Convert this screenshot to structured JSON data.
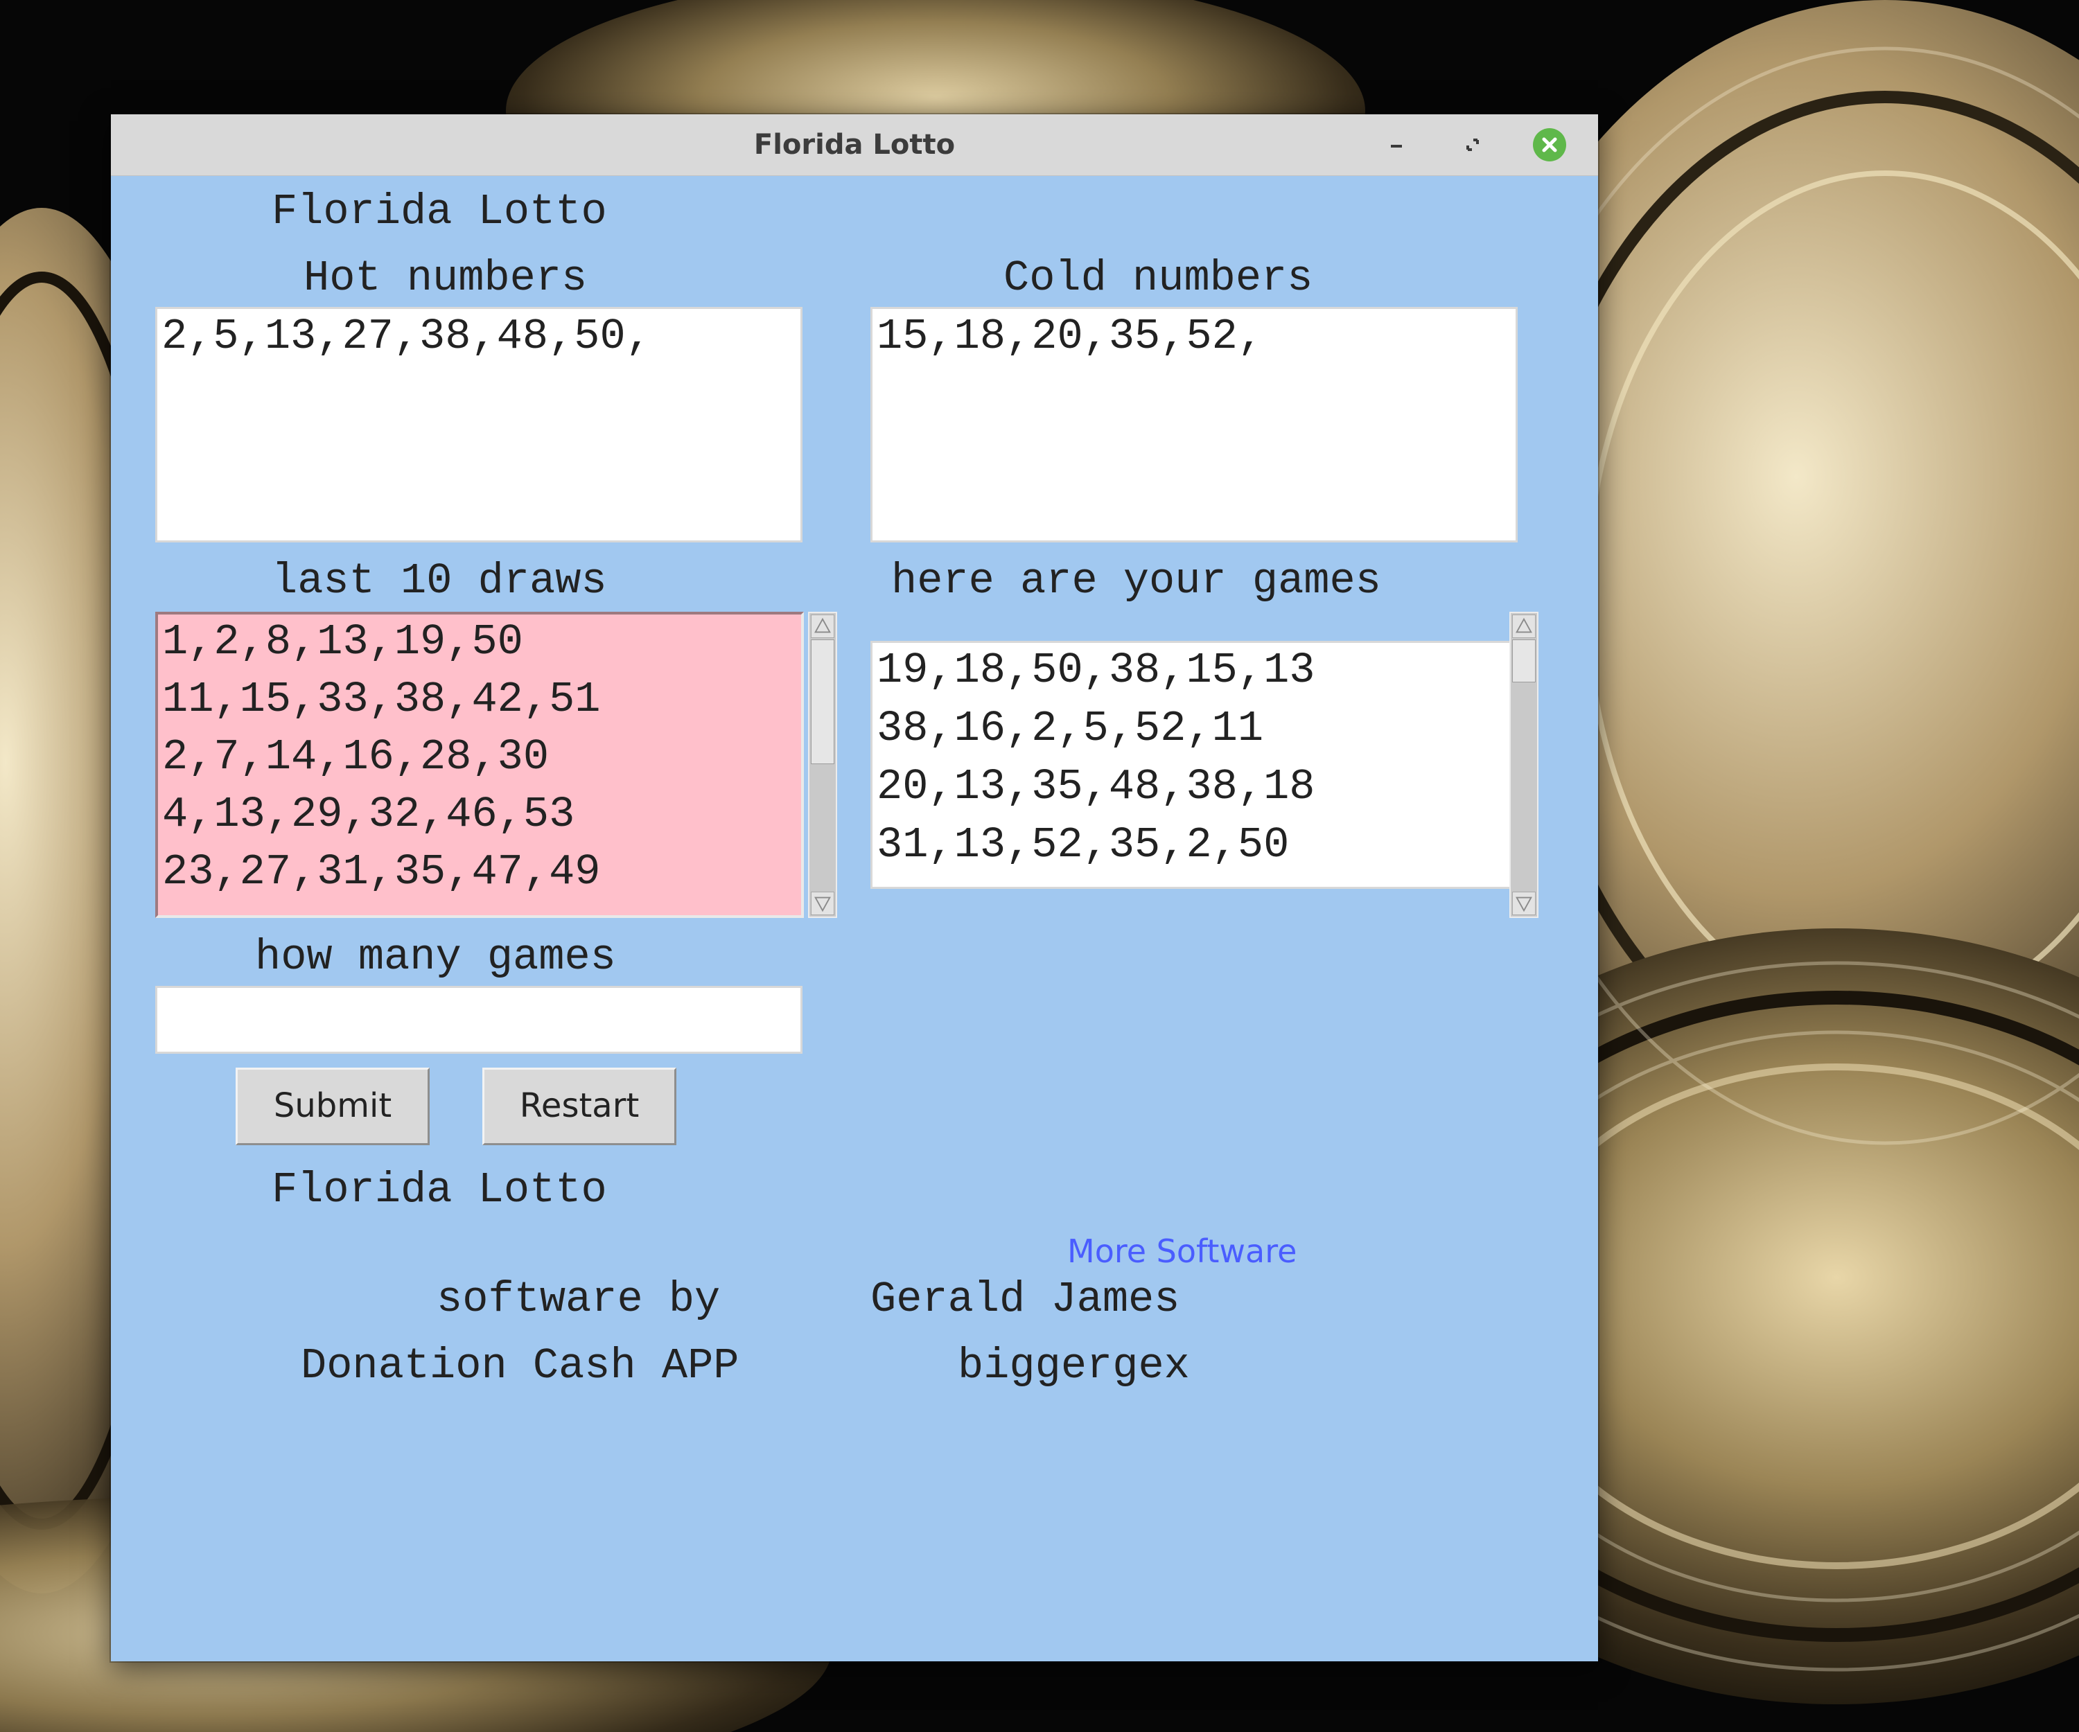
{
  "window": {
    "title": "Florida Lotto",
    "controls": {
      "minimize": "-",
      "maximize": "restore-icon",
      "close": "close-icon"
    }
  },
  "app": {
    "heading": "Florida Lotto",
    "hot_label": "Hot numbers",
    "hot_value": "2,5,13,27,38,48,50,",
    "cold_label": "Cold numbers",
    "cold_value": "15,18,20,35,52,",
    "draws_label": "last 10 draws",
    "draws": [
      "1,2,8,13,19,50",
      "11,15,33,38,42,51",
      "2,7,14,16,28,30",
      "4,13,29,32,46,53",
      "23,27,31,35,47,49"
    ],
    "games_label": "here are your games",
    "games": [
      "19,18,50,38,15,13",
      "38,16,2,5,52,11",
      "20,13,35,48,38,18",
      "31,13,52,35,2,50"
    ],
    "how_many_label": "how many games",
    "how_many_value": "",
    "submit_label": "Submit",
    "restart_label": "Restart",
    "footer_title": "Florida Lotto",
    "more_software": "More Software",
    "credit_prefix": "software by",
    "credit_name": "Gerald James",
    "donation_prefix": "Donation Cash APP",
    "donation_handle": "biggergex"
  },
  "colors": {
    "window_bg": "#a1c8f0",
    "draws_bg": "#ffc0cb",
    "link": "#4a5dff",
    "close_button": "#5fb84a"
  }
}
